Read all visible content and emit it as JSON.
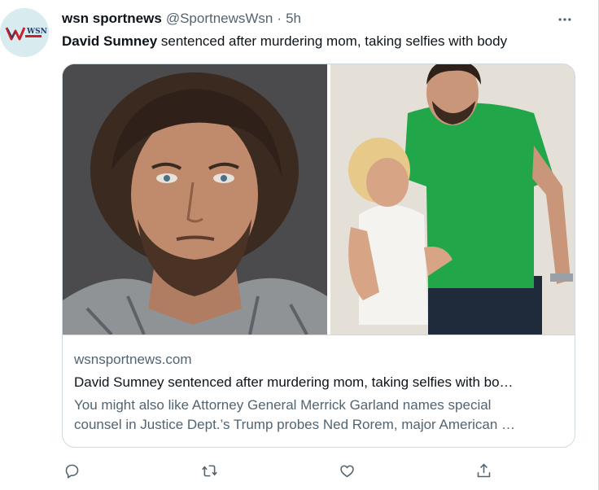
{
  "tweet": {
    "author_name": "wsn sportnews",
    "author_handle": "@SportnewsWsn",
    "separator": "·",
    "time": "5h",
    "text_bold": "David Sumney",
    "text_rest": " sentenced after murdering mom, taking selfies with body",
    "avatar_label": "WSN",
    "more_icon": "more-icon"
  },
  "card": {
    "domain": "wsnsportnews.com",
    "title": "David Sumney sentenced after murdering mom, taking selfies with bo…",
    "description_line1": "You might also like Attorney General Merrick Garland names special",
    "description_line2": "counsel in Justice Dept.’s Trump probes Ned Rorem, major American …"
  },
  "actions": [
    {
      "icon": "reply-icon"
    },
    {
      "icon": "retweet-icon"
    },
    {
      "icon": "like-icon"
    },
    {
      "icon": "share-icon"
    }
  ],
  "colors": {
    "text": "#0f1419",
    "secondary": "#536471",
    "border": "#cfd9de",
    "avatar_bg": "#d8ecef",
    "brand_red": "#c8232c"
  }
}
